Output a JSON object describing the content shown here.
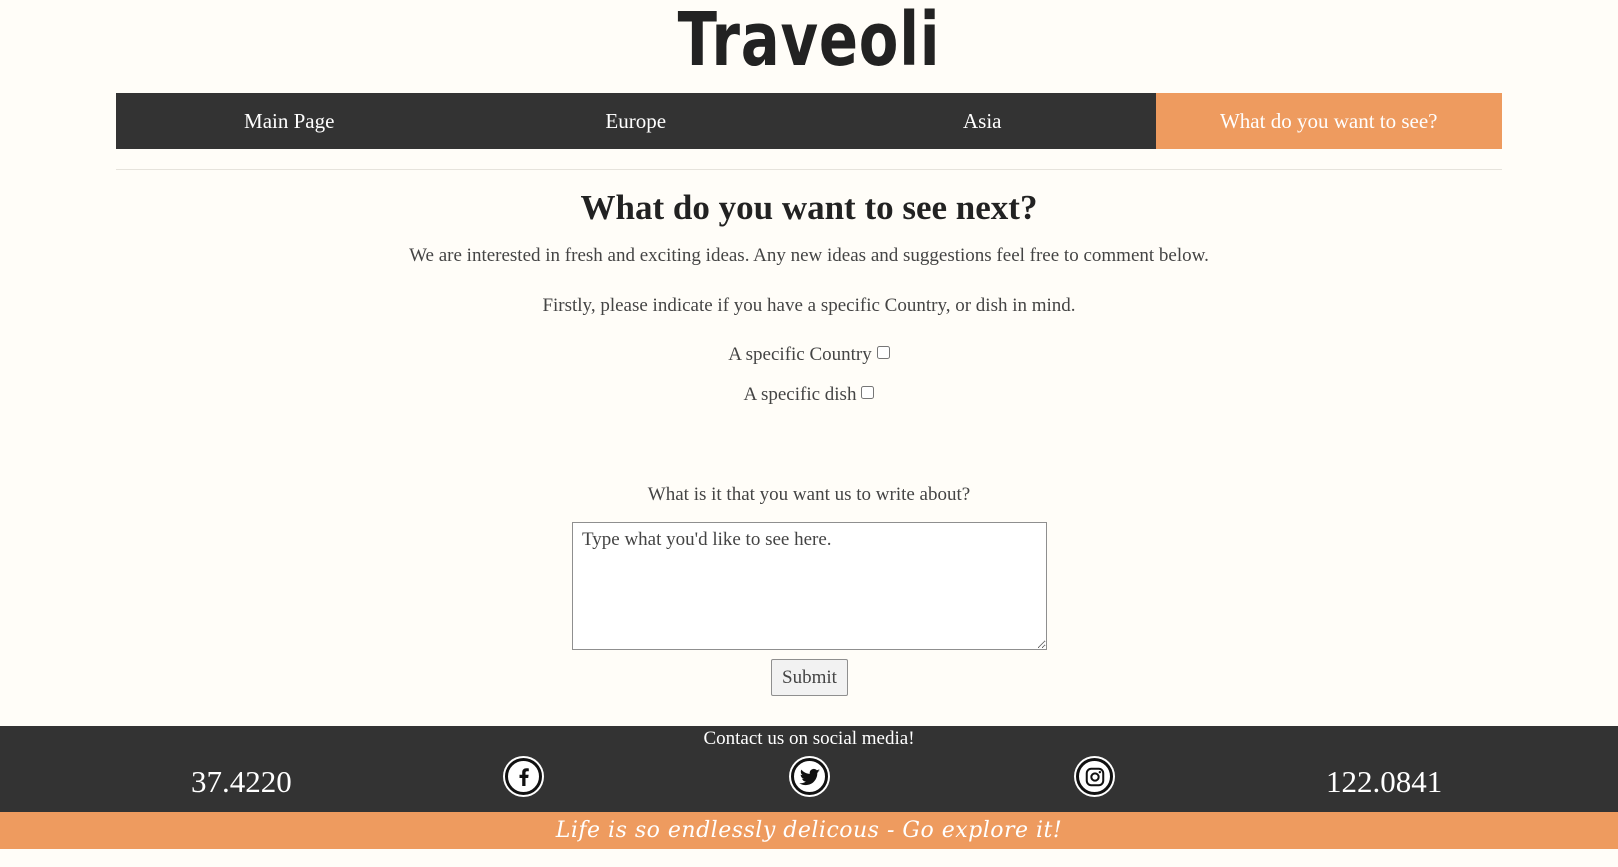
{
  "site": {
    "title": "Traveoli"
  },
  "nav": {
    "items": [
      {
        "label": "Main Page"
      },
      {
        "label": "Europe"
      },
      {
        "label": "Asia"
      },
      {
        "label": "What do you want to see?"
      }
    ],
    "active_index": 3
  },
  "main": {
    "heading": "What do you want to see next?",
    "intro": "We are interested in fresh and exciting ideas. Any new ideas and suggestions feel free to comment below.",
    "prompt": "Firstly, please indicate if you have a specific Country, or dish in mind.",
    "checkboxes": [
      {
        "label": "A specific Country",
        "checked": false
      },
      {
        "label": "A specific dish",
        "checked": false
      }
    ],
    "question": "What is it that you want us to write about?",
    "textarea_placeholder": "Type what you'd like to see here.",
    "submit_label": "Submit"
  },
  "footer": {
    "heading": "Contact us on social media!",
    "left_coord": "37.4220",
    "right_coord": "122.0841",
    "social_icons": [
      "facebook-icon",
      "twitter-icon",
      "instagram-icon"
    ],
    "tagline": "Life is so endlessly delicous - Go explore it!"
  },
  "colors": {
    "background": "#fffdf8",
    "nav_bg": "#333333",
    "accent": "#ee9b5f",
    "footer_bg": "#333333"
  }
}
